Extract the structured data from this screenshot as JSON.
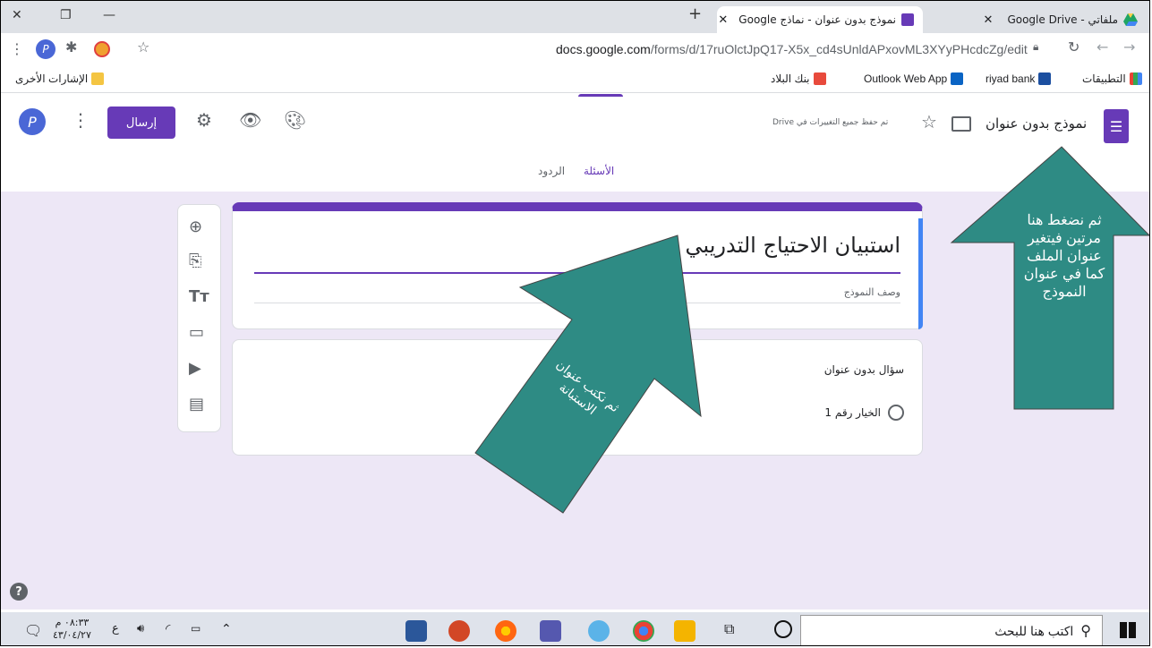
{
  "browser": {
    "tabs": [
      {
        "title": "ملفاتي - Google Drive"
      },
      {
        "title": "نموذج بدون عنوان - نماذج Google"
      }
    ],
    "new_tab": "+",
    "url_host": "docs.google.com",
    "url_path": "/forms/d/17ruOlctJpQ17-X5x_cd4sUnldAPxovML3XYyPHcdcZg/edit",
    "avatar_letter": "P",
    "bookmarks": [
      {
        "label": "التطبيقات"
      },
      {
        "label": "riyad bank"
      },
      {
        "label": "Outlook Web App"
      },
      {
        "label": "بنك البلاد"
      }
    ],
    "other_bookmarks": "الإشارات الأخرى"
  },
  "form_header": {
    "doc_title": "نموذج بدون عنوان",
    "save_status": "تم حفظ جميع التغييرات في Drive",
    "send_label": "إرسال",
    "avatar_letter": "P",
    "tabs": [
      {
        "label": "الأسئلة"
      },
      {
        "label": "الردود"
      }
    ]
  },
  "form": {
    "title": "استبيان الاحتياج التدريبي",
    "description_placeholder": "وصف النموذج",
    "question_title": "سؤال بدون عنوان",
    "option_label": "الخيار رقم 1"
  },
  "annotations": {
    "arrow_right_text": "ثم نضغط هنا مرتين فيتغير عنوان الملف كما في عنوان النموذج",
    "arrow_center_text": "ثم نكتب عنوان الاستبانة",
    "arrow_color": "#2e8b84"
  },
  "taskbar": {
    "search_placeholder": "اكتب هنا للبحث",
    "time": "٠٨:٣٣ م",
    "date": "٤٣/٠٤/٢٧",
    "lang": "ع"
  }
}
